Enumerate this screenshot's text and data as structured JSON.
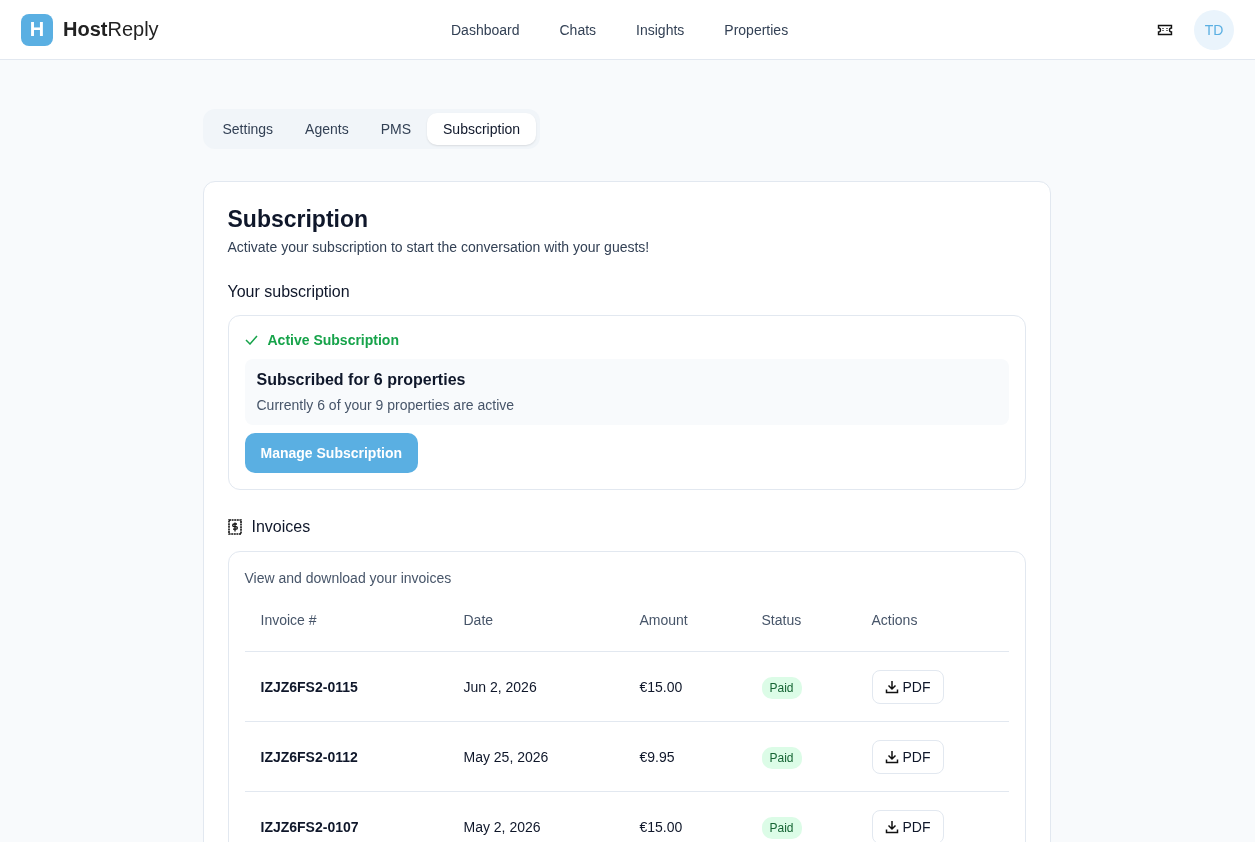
{
  "brand": {
    "logo_letter": "H",
    "name": "**Host**Reply"
  },
  "nav": [
    {
      "label": "Dashboard"
    },
    {
      "label": "Chats"
    },
    {
      "label": "Insights"
    },
    {
      "label": "Properties"
    }
  ],
  "user": {
    "initials": "TD"
  },
  "tabs": [
    {
      "label": "Settings",
      "selected": false
    },
    {
      "label": "Agents",
      "selected": false
    },
    {
      "label": "PMS",
      "selected": false
    },
    {
      "label": "Subscription",
      "selected": true
    }
  ],
  "page": {
    "title": "Subscription",
    "subtitle": "Activate your subscription to start the conversation with your guests!"
  },
  "subscription": {
    "heading": "Your subscription",
    "status": "Active Subscription",
    "active": true,
    "plan_title": "Subscribed for 6 properties",
    "plan_detail": "Currently 6 of your 9 properties are active",
    "button": "Manage Subscription"
  },
  "invoices": {
    "heading": "Invoices",
    "description": "View and download your invoices",
    "columns": [
      "Invoice #",
      "Date",
      "Amount",
      "Status",
      "Actions"
    ],
    "rows": [
      {
        "number": "IZJZ6FS2-0115",
        "date": "Jun 2, 2026",
        "amount": "€15.00",
        "status": "Paid",
        "action": "PDF"
      },
      {
        "number": "IZJZ6FS2-0112",
        "date": "May 25, 2026",
        "amount": "€9.95",
        "status": "Paid",
        "action": "PDF"
      },
      {
        "number": "IZJZ6FS2-0107",
        "date": "May 2, 2026",
        "amount": "€15.00",
        "status": "Paid",
        "action": "PDF"
      }
    ]
  }
}
